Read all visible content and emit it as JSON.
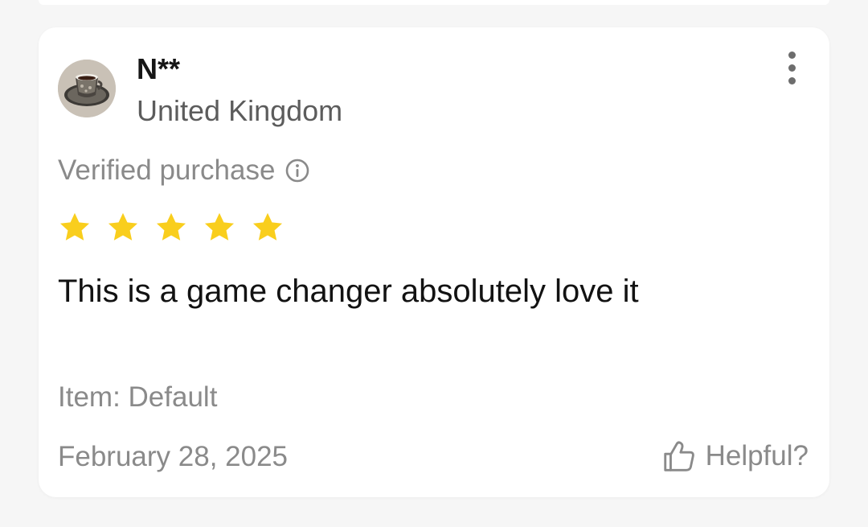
{
  "review": {
    "reviewer_name": "N**",
    "reviewer_country": "United Kingdom",
    "verified_label": "Verified purchase",
    "rating": 5,
    "rating_max": 5,
    "text": "This is a game changer absolutely love it",
    "item_variant": "Item: Default",
    "date": "February 28, 2025",
    "helpful_label": "Helpful?"
  },
  "icons": {
    "avatar": "coffee-cup-avatar",
    "menu": "more-vertical-icon",
    "info": "info-icon",
    "star": "star-icon",
    "helpful": "thumbs-up-icon"
  },
  "colors": {
    "star": "#F9CE1D",
    "secondary_text": "#8A8A8A",
    "primary_text": "#121212"
  }
}
